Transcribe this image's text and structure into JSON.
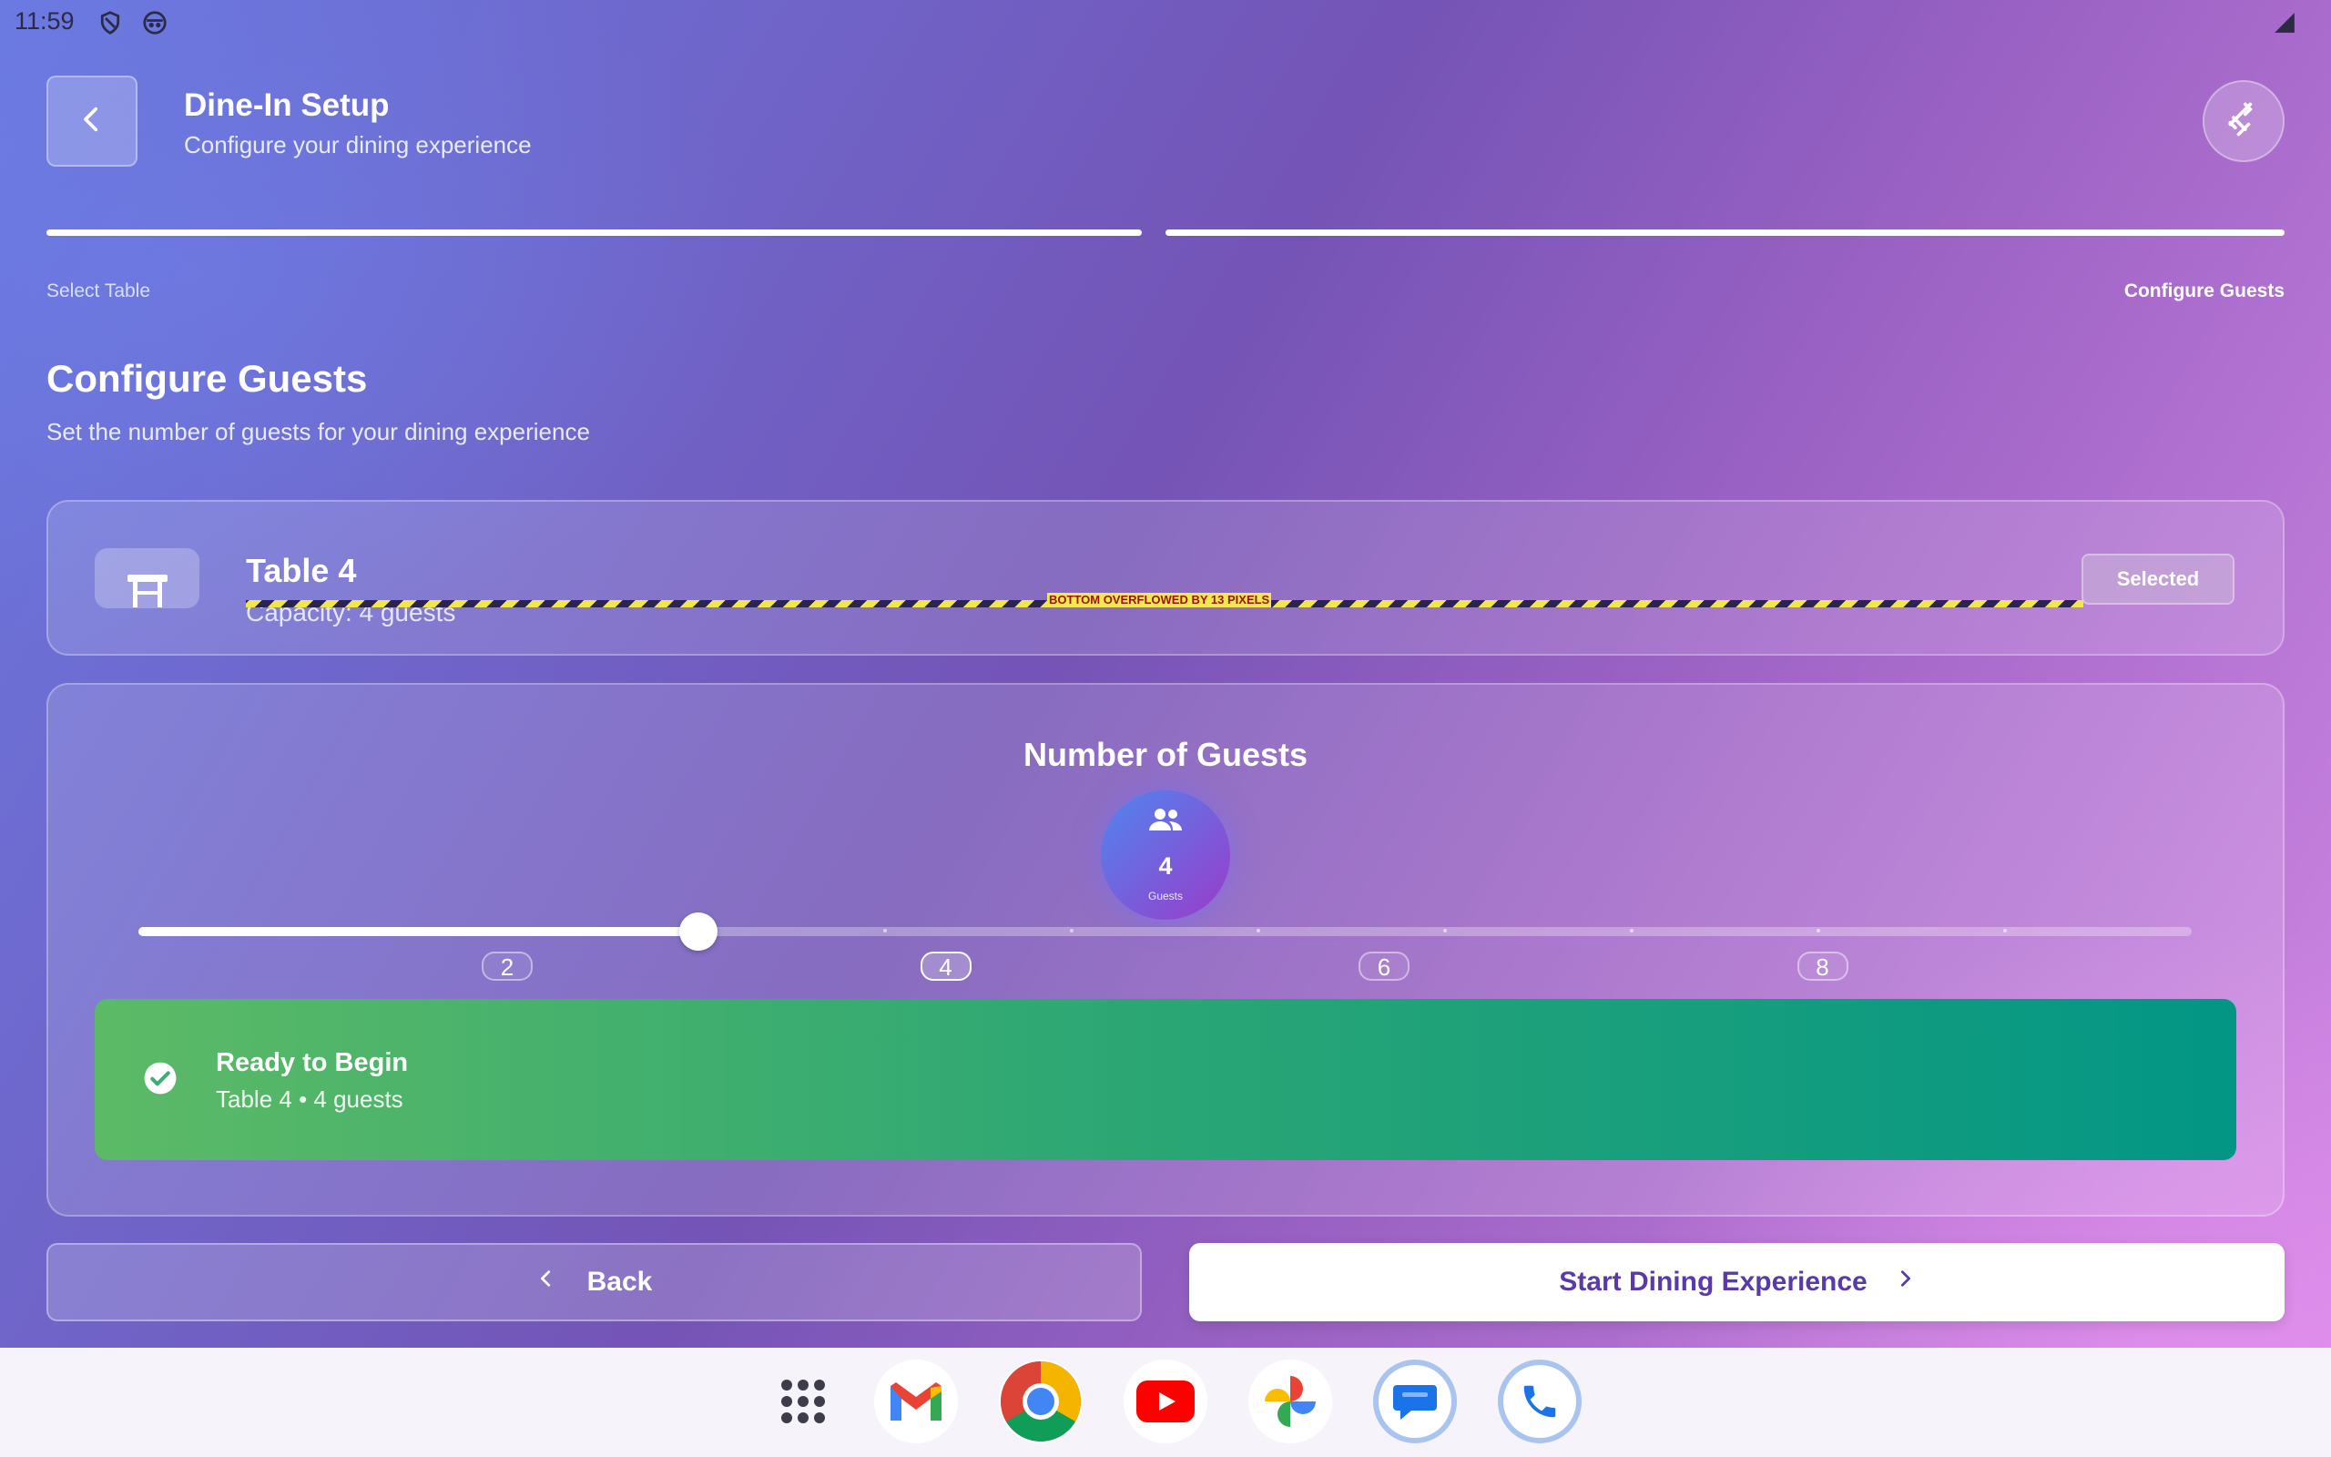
{
  "status_bar": {
    "time": "11:59",
    "icons": [
      "shield-icon",
      "face-icon",
      "signal-icon"
    ]
  },
  "header": {
    "title": "Dine-In Setup",
    "subtitle": "Configure your dining experience",
    "back_icon": "chevron-left-icon",
    "action_icon": "utensils-icon"
  },
  "progress": {
    "steps": [
      {
        "label": "Select Table",
        "complete": true
      },
      {
        "label": "Configure Guests",
        "complete": true,
        "current": true
      }
    ]
  },
  "section": {
    "title": "Configure Guests",
    "subtitle": "Set the number of guests for your dining experience"
  },
  "table_card": {
    "name": "Table 4",
    "capacity": "Capacity: 4 guests",
    "badge": "Selected",
    "overflow_warning": "BOTTOM OVERFLOWED BY 13 PIXELS",
    "icon": "table-icon"
  },
  "guests": {
    "title": "Number of Guests",
    "count": "4",
    "count_label": "Guests",
    "icon": "people-icon",
    "slider": {
      "min": 1,
      "max": 12,
      "value": 4,
      "tick_labels": [
        "2",
        "4",
        "6",
        "8"
      ]
    }
  },
  "ready": {
    "title": "Ready to Begin",
    "subtitle": "Table 4 • 4 guests",
    "icon": "check-circle-icon"
  },
  "buttons": {
    "back": "Back",
    "start": "Start Dining Experience"
  },
  "dock": {
    "apps": [
      "app-drawer-icon",
      "gmail-icon",
      "chrome-icon",
      "youtube-icon",
      "photos-icon",
      "messages-icon",
      "phone-icon"
    ]
  },
  "colors": {
    "accent": "#5a3aa8",
    "ready_start": "#5cba66",
    "ready_end": "#039685"
  }
}
